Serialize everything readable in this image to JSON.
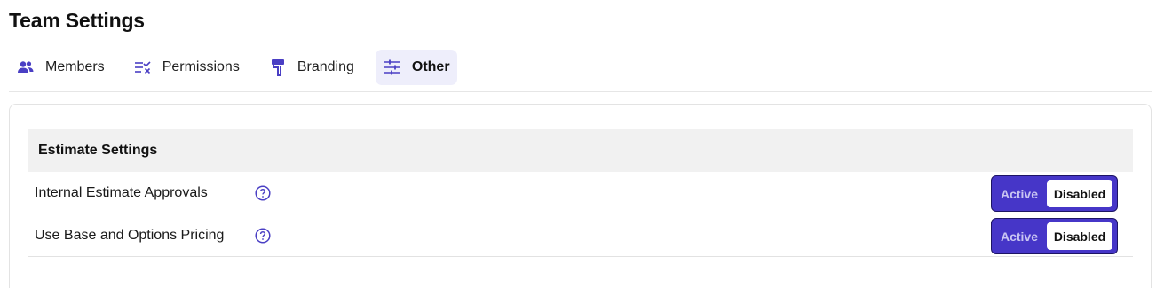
{
  "page": {
    "title": "Team Settings"
  },
  "tabs": [
    {
      "label": "Members",
      "icon": "members-icon",
      "active": false
    },
    {
      "label": "Permissions",
      "icon": "permissions-icon",
      "active": false
    },
    {
      "label": "Branding",
      "icon": "branding-icon",
      "active": false
    },
    {
      "label": "Other",
      "icon": "sliders-icon",
      "active": true
    }
  ],
  "estimate_settings": {
    "title": "Estimate Settings",
    "rows": [
      {
        "label": "Internal Estimate Approvals",
        "help_icon": "help-icon",
        "active_label": "Active",
        "disabled_label": "Disabled",
        "selected": "Disabled"
      },
      {
        "label": "Use Base and Options Pricing",
        "help_icon": "help-icon",
        "active_label": "Active",
        "disabled_label": "Disabled",
        "selected": "Disabled"
      }
    ]
  },
  "colors": {
    "accent": "#4636c8",
    "accent_dark": "#1d1465",
    "tab_active_bg": "#eeeefb",
    "section_bg": "#f1f1f1"
  }
}
